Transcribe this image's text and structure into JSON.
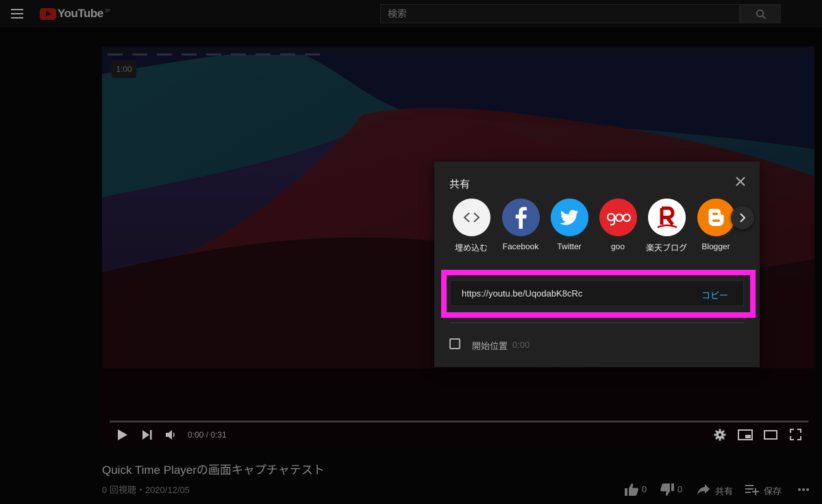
{
  "header": {
    "logo_text": "YouTube",
    "logo_region": "JP",
    "search_placeholder": "検索"
  },
  "player": {
    "timestamp_badge": "1:00",
    "time_display": "0:00 / 0:31",
    "progress": 0
  },
  "share": {
    "title": "共有",
    "items": [
      {
        "label": "埋め込む",
        "icon": "embed-icon",
        "color": "#f2f2f2"
      },
      {
        "label": "Facebook",
        "icon": "facebook-icon",
        "color": "#3b5998"
      },
      {
        "label": "Twitter",
        "icon": "twitter-icon",
        "color": "#1da1f2"
      },
      {
        "label": "goo",
        "icon": "goo-icon",
        "color": "#e3242b"
      },
      {
        "label": "楽天ブログ",
        "icon": "rakuten-icon",
        "color": "#ffffff"
      },
      {
        "label": "Blogger",
        "icon": "blogger-icon",
        "color": "#f57d00"
      }
    ],
    "url": "https://youtu.be/UqodabK8cRc",
    "copy_label": "コピー",
    "start_label": "開始位置",
    "start_time": "0:00",
    "highlight_color": "#ff1fe6"
  },
  "video": {
    "title": "Quick Time Playerの画面キャプチャテスト",
    "meta": "0 回視聴・2020/12/05",
    "likes": "0",
    "dislikes": "0",
    "share_label": "共有",
    "save_label": "保存"
  }
}
